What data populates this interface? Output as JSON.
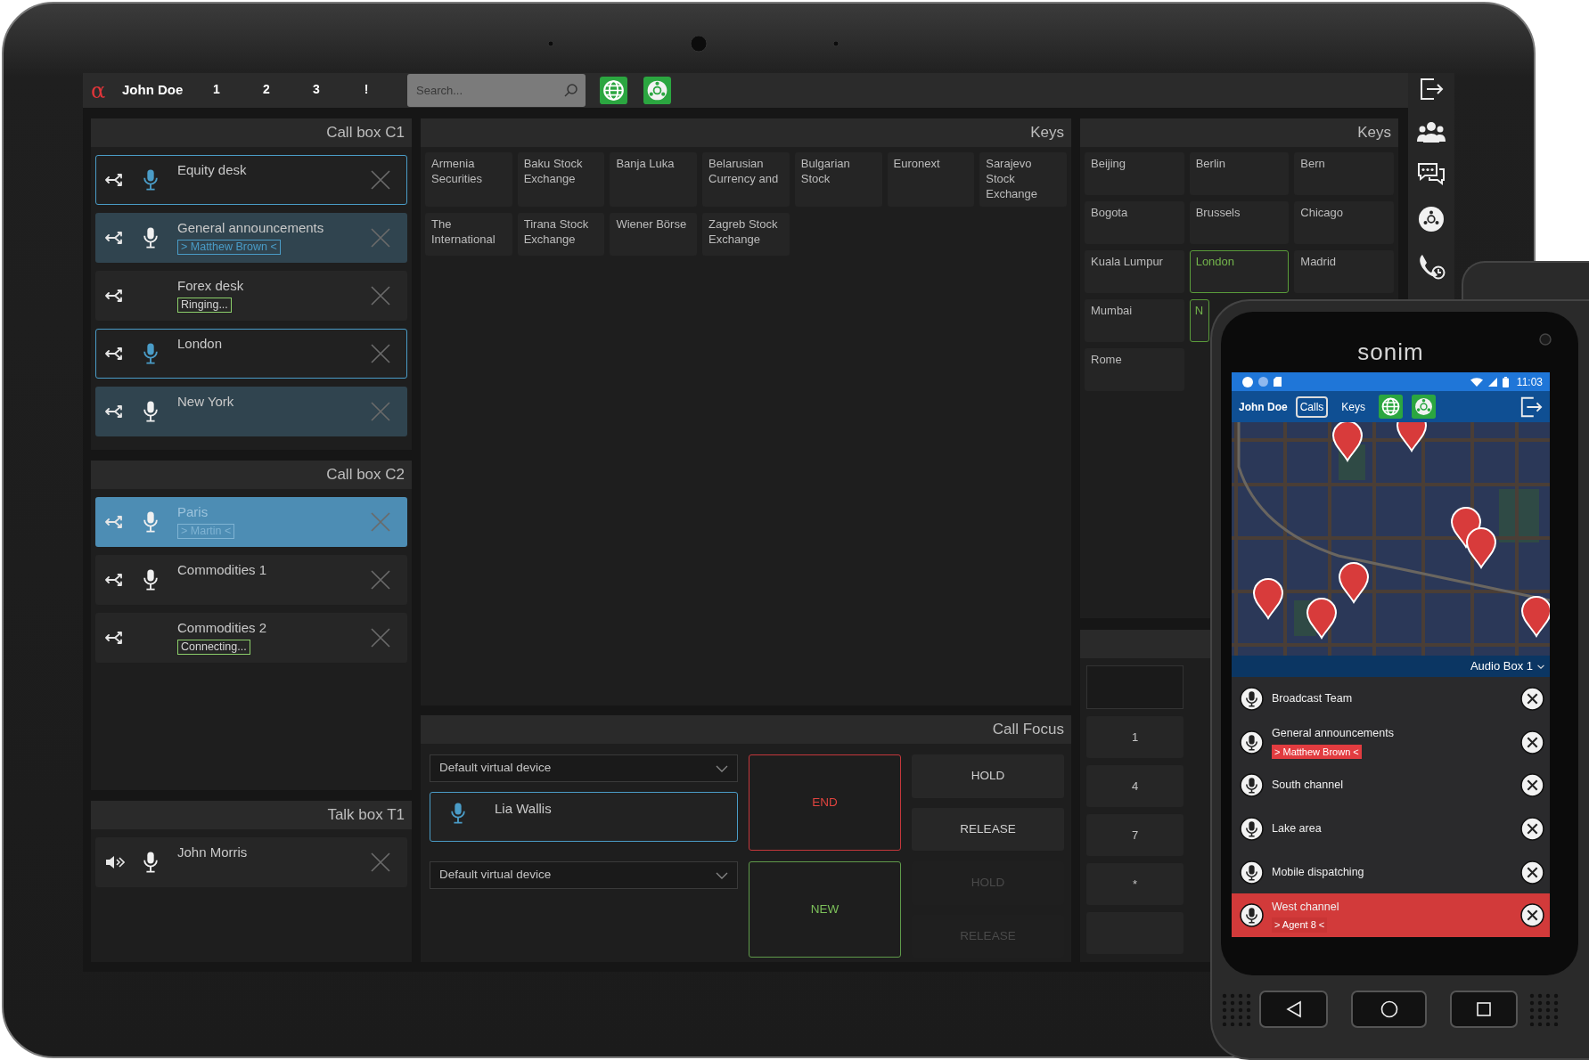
{
  "tablet": {
    "top_bar": {
      "logo": "α",
      "user": "John Doe",
      "tabs": [
        {
          "label": "1",
          "selected": false
        },
        {
          "label": "2",
          "selected": false
        },
        {
          "label": "3",
          "selected": false
        },
        {
          "label": "!",
          "selected": false
        }
      ],
      "search": {
        "placeholder": "Search..."
      }
    },
    "call_boxes": [
      {
        "title": "Call box C1",
        "calls": [
          {
            "kind": "call",
            "name": "Equity desk",
            "focused": true,
            "connected": false,
            "selected": false,
            "mic": true
          },
          {
            "kind": "call",
            "name": "General announcements",
            "focused": false,
            "connected": true,
            "selected": false,
            "mic": true,
            "tag": {
              "text": "> Matthew Brown <",
              "kind": "party"
            }
          },
          {
            "kind": "call",
            "name": "Forex desk",
            "focused": false,
            "connected": false,
            "selected": false,
            "mic": false,
            "tag": {
              "text": "Ringing...",
              "kind": "status"
            }
          },
          {
            "kind": "call",
            "name": "London",
            "focused": true,
            "connected": false,
            "selected": false,
            "mic": true
          },
          {
            "kind": "call",
            "name": "New York",
            "focused": false,
            "connected": true,
            "selected": false,
            "mic": true
          }
        ]
      },
      {
        "title": "Call box C2",
        "calls": [
          {
            "kind": "call",
            "name": "Paris",
            "focused": false,
            "connected": false,
            "selected": true,
            "mic": true,
            "tag": {
              "text": "> Martin <",
              "kind": "party"
            }
          },
          {
            "kind": "call",
            "name": "Commodities 1",
            "focused": false,
            "connected": false,
            "selected": false,
            "mic": true
          },
          {
            "kind": "call",
            "name": "Commodities 2",
            "focused": false,
            "connected": false,
            "selected": false,
            "mic": false,
            "tag": {
              "text": "Connecting...",
              "kind": "status"
            }
          }
        ]
      },
      {
        "title": "Talk box T1",
        "calls": [
          {
            "kind": "talk",
            "name": "John Morris",
            "focused": false,
            "connected": false,
            "selected": false,
            "mic": true
          }
        ]
      }
    ],
    "keys_panels": [
      {
        "title": "Keys",
        "rows": [
          [
            {
              "label": "Armenia Securities",
              "selected": false
            },
            {
              "label": "Baku Stock Exchange",
              "selected": false
            },
            {
              "label": "Banja Luka",
              "selected": false
            },
            {
              "label": "Belarusian Currency and",
              "selected": false
            },
            {
              "label": "Bulgarian Stock",
              "selected": false
            },
            {
              "label": "Euronext",
              "selected": false
            },
            {
              "label": "Sarajevo Stock Exchange",
              "selected": false
            }
          ],
          [
            {
              "label": "The International",
              "selected": false
            },
            {
              "label": "Tirana Stock Exchange",
              "selected": false
            },
            {
              "label": "Wiener Börse",
              "selected": false
            },
            {
              "label": "Zagreb Stock Exchange",
              "selected": false
            }
          ]
        ]
      },
      {
        "title": "Keys",
        "rows": [
          [
            {
              "label": "Beijing",
              "selected": false
            },
            {
              "label": "Berlin",
              "selected": false
            },
            {
              "label": "Bern",
              "selected": false
            }
          ],
          [
            {
              "label": "Bogota",
              "selected": false
            },
            {
              "label": "Brussels",
              "selected": false
            },
            {
              "label": "Chicago",
              "selected": false
            }
          ],
          [
            {
              "label": "Kuala Lumpur",
              "selected": false
            },
            {
              "label": "London",
              "selected": true
            },
            {
              "label": "Madrid",
              "selected": false
            }
          ],
          [
            {
              "label": "Mumbai",
              "selected": false
            },
            {
              "label": "N",
              "selected": true
            }
          ],
          [
            {
              "label": "Rome",
              "selected": false
            }
          ]
        ]
      }
    ],
    "call_focus": {
      "title": "Call Focus",
      "lines": [
        {
          "device": "Default virtual device",
          "caller": {
            "name": "Lia Wallis",
            "mic": true
          },
          "main_action": {
            "label": "END",
            "kind": "end"
          },
          "buttons": [
            {
              "label": "HOLD",
              "disabled": false
            },
            {
              "label": "RELEASE",
              "disabled": false
            }
          ]
        },
        {
          "device": "Default virtual device",
          "main_action": {
            "label": "NEW",
            "kind": "new"
          },
          "buttons": [
            {
              "label": "HOLD",
              "disabled": true
            },
            {
              "label": "RELEASE",
              "disabled": true
            }
          ]
        }
      ]
    },
    "keypad": {
      "keys": [
        {
          "kind": "digit",
          "label": "1"
        },
        {
          "kind": "digit",
          "label": "4"
        },
        {
          "kind": "digit",
          "label": "7"
        },
        {
          "kind": "digit",
          "label": "*"
        },
        {
          "kind": "blank"
        }
      ]
    }
  },
  "phone": {
    "brand": "sonim",
    "status_bar": {
      "time": "11:03"
    },
    "app_bar": {
      "user": "John Doe",
      "tabs": [
        {
          "label": "Calls",
          "selected": true
        },
        {
          "label": "Keys",
          "selected": false
        }
      ]
    },
    "audio_box": {
      "label": "Audio Box 1"
    },
    "channels": [
      {
        "name": "Broadcast Team",
        "selected": false
      },
      {
        "name": "General announcements",
        "tag": "> Matthew Brown <",
        "selected": false
      },
      {
        "name": "South channel",
        "selected": false
      },
      {
        "name": "Lake area",
        "selected": false
      },
      {
        "name": "Mobile dispatching",
        "selected": false
      },
      {
        "name": "West channel",
        "tag": "> Agent 8 <",
        "selected": true
      }
    ]
  }
}
